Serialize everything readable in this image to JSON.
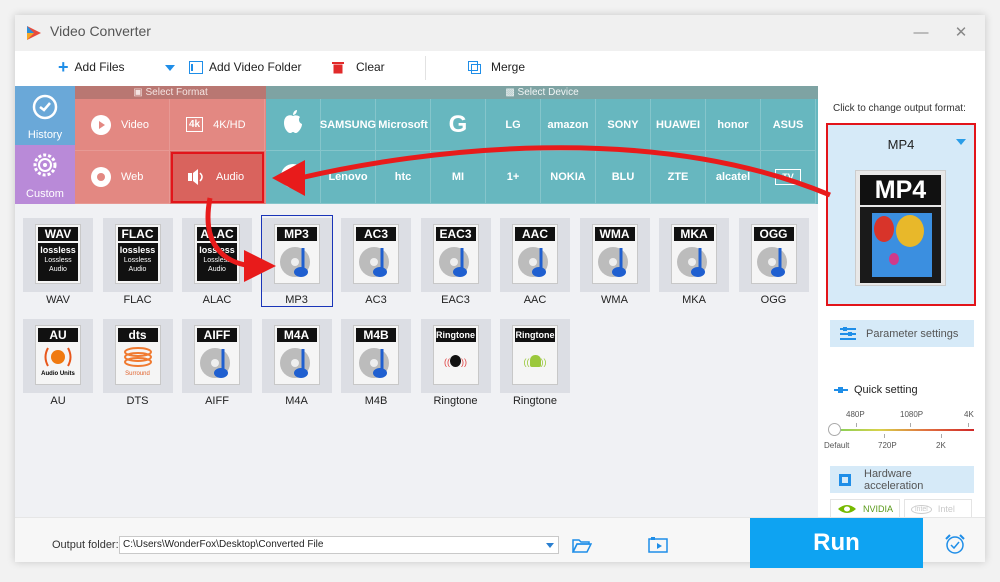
{
  "window": {
    "title": "Video Converter"
  },
  "toolbar": {
    "add_files": "Add Files",
    "add_video_folder": "Add Video Folder",
    "clear": "Clear",
    "merge": "Merge"
  },
  "sidebar": {
    "history": "History",
    "custom": "Custom"
  },
  "select_format": {
    "header": "Select Format",
    "items": [
      {
        "label": "Video",
        "icon": "play-icon"
      },
      {
        "label": "4K/HD",
        "icon": "4k-icon"
      },
      {
        "label": "Web",
        "icon": "chrome-icon"
      },
      {
        "label": "Audio",
        "icon": "speaker-icon",
        "active": true
      }
    ]
  },
  "select_device": {
    "header": "Select Device",
    "row1": [
      "Apple",
      "SAMSUNG",
      "Microsoft",
      "G",
      "LG",
      "amazon",
      "SONY",
      "HUAWEI",
      "honor",
      "ASUS"
    ],
    "row2": [
      "Motorola",
      "Lenovo",
      "htc",
      "MI",
      "1+",
      "NOKIA",
      "BLU",
      "ZTE",
      "alcatel",
      "TV"
    ]
  },
  "formats": [
    {
      "band": "WAV",
      "label": "WAV",
      "kind": "lossless",
      "sub": "Lossless Audio"
    },
    {
      "band": "FLAC",
      "label": "FLAC",
      "kind": "lossless",
      "sub": "Lossless Audio"
    },
    {
      "band": "ALAC",
      "label": "ALAC",
      "kind": "lossless",
      "sub": "Lossless Audio"
    },
    {
      "band": "MP3",
      "label": "MP3",
      "kind": "disc",
      "selected": true
    },
    {
      "band": "AC3",
      "label": "AC3",
      "kind": "disc"
    },
    {
      "band": "EAC3",
      "label": "EAC3",
      "kind": "disc"
    },
    {
      "band": "AAC",
      "label": "AAC",
      "kind": "disc"
    },
    {
      "band": "WMA",
      "label": "WMA",
      "kind": "disc"
    },
    {
      "band": "MKA",
      "label": "MKA",
      "kind": "disc"
    },
    {
      "band": "OGG",
      "label": "OGG",
      "kind": "disc"
    },
    {
      "band": "AU",
      "label": "AU",
      "kind": "au",
      "sub": "Audio Units"
    },
    {
      "band": "dts",
      "label": "DTS",
      "kind": "dts",
      "sub": "Surround"
    },
    {
      "band": "AIFF",
      "label": "AIFF",
      "kind": "disc"
    },
    {
      "band": "M4A",
      "label": "M4A",
      "kind": "disc"
    },
    {
      "band": "M4B",
      "label": "M4B",
      "kind": "disc"
    },
    {
      "band": "Ringtone",
      "label": "Ringtone",
      "kind": "ring-apple"
    },
    {
      "band": "Ringtone",
      "label": "Ringtone",
      "kind": "ring-android"
    }
  ],
  "output_panel": {
    "caption": "Click to change output format:",
    "format": "MP4",
    "parameter_settings": "Parameter settings",
    "quick_setting": "Quick setting",
    "ticks_top": [
      "480P",
      "1080P",
      "4K"
    ],
    "ticks_bottom": [
      "Default",
      "720P",
      "2K"
    ],
    "quick_setting_value": "Default",
    "hardware_acceleration": "Hardware acceleration",
    "nvidia": "NVIDIA",
    "intel": "Intel"
  },
  "bottom": {
    "output_folder_label": "Output folder:",
    "output_folder_value": "C:\\Users\\WonderFox\\Desktop\\Converted File",
    "run": "Run"
  },
  "colors": {
    "accent": "#0ea3f2",
    "format_panel": "#e38882",
    "device_panel": "#67b7bf",
    "highlight": "#e2141a"
  }
}
